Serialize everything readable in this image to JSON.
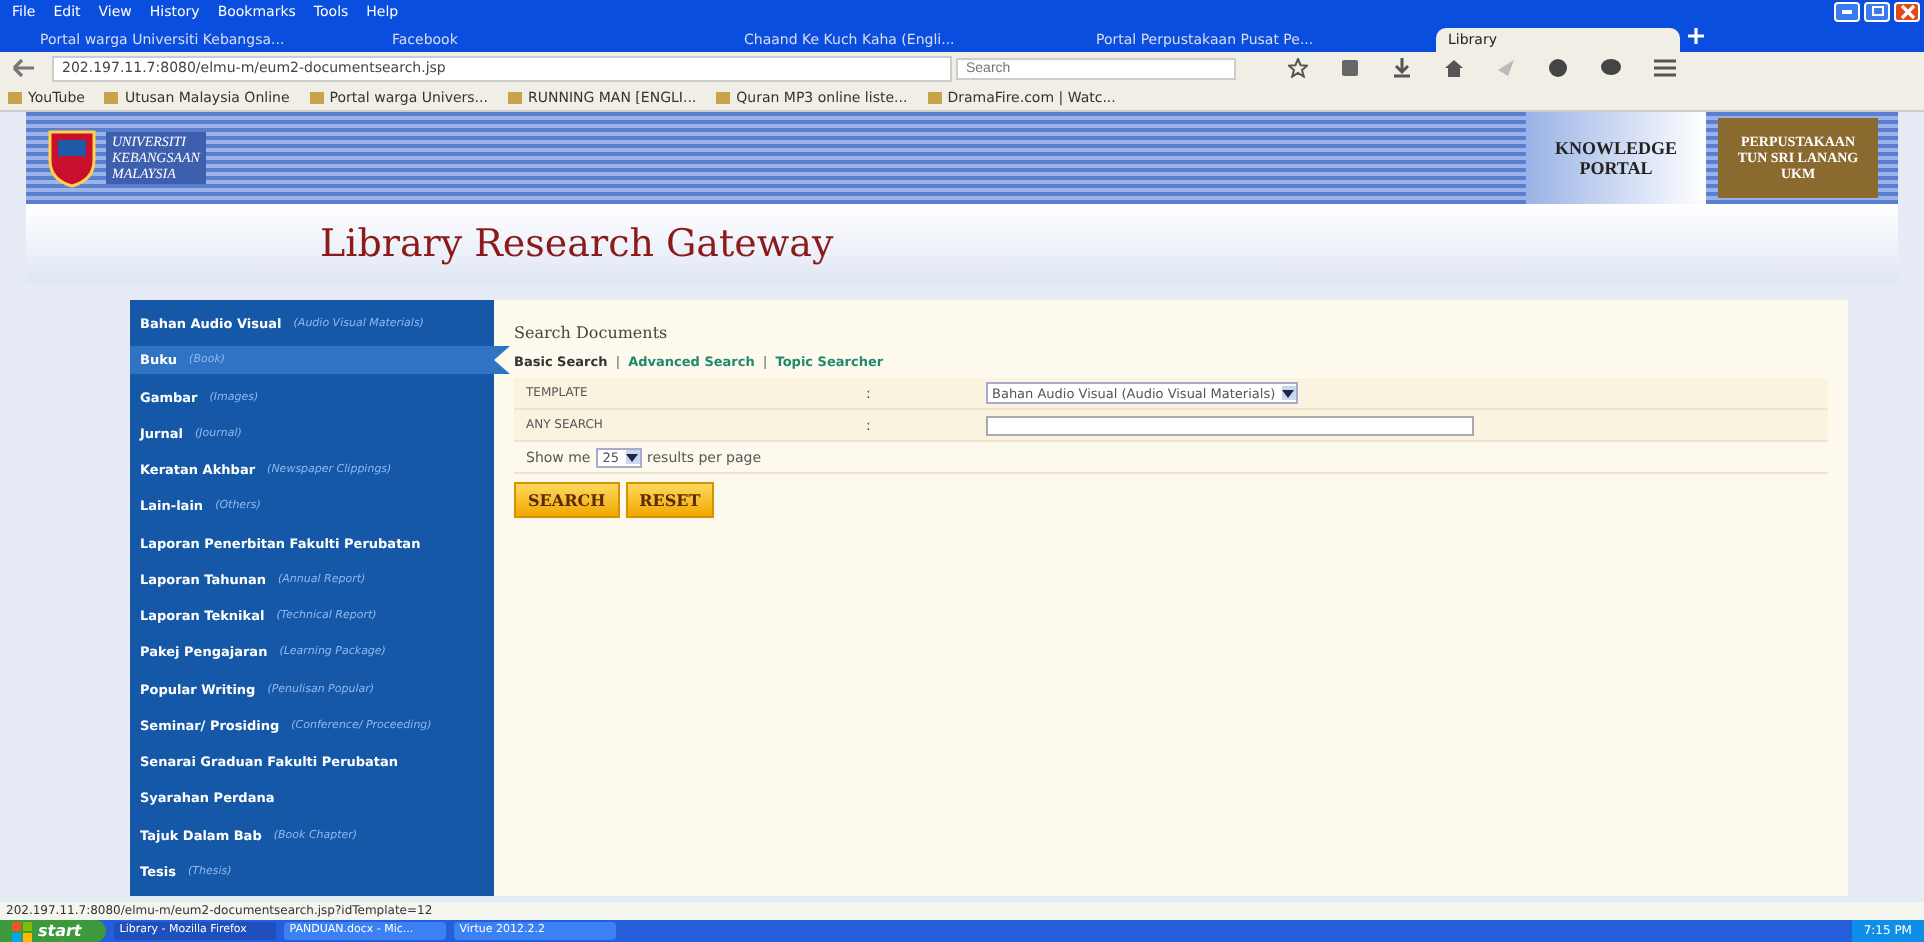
{
  "browser": {
    "menu": [
      "File",
      "Edit",
      "View",
      "History",
      "Bookmarks",
      "Tools",
      "Help"
    ],
    "tabs": [
      {
        "label": "Portal warga Universiti Kebangsa...",
        "selected": false
      },
      {
        "label": "Facebook",
        "selected": false
      },
      {
        "label": "Chaand Ke Kuch Kaha (Engli...",
        "selected": false
      },
      {
        "label": "Portal Perpustakaan Pusat Pe...",
        "selected": false
      },
      {
        "label": "Library",
        "selected": true
      }
    ],
    "url": "202.197.11.7:8080/elmu-m/eum2-documentsearch.jsp",
    "search_placeholder": "Search",
    "bookmarks": [
      "YouTube",
      "Utusan Malaysia Online",
      "Portal warga Univers...",
      "RUNNING MAN [ENGLI...",
      "Quran MP3 online liste...",
      "DramaFire.com | Watc..."
    ]
  },
  "header": {
    "university": [
      "UNIVERSITI",
      "KEBANGSAAN",
      "MALAYSIA"
    ],
    "portal": [
      "KNOWLEDGE",
      "PORTAL"
    ],
    "library": [
      "PERPUSTAKAAN",
      "TUN SRI LANANG",
      "UKM"
    ]
  },
  "title": "Library Research Gateway",
  "sidebar": {
    "items": [
      {
        "label": "Bahan Audio Visual",
        "english": "(Audio Visual Materials)",
        "selected": false
      },
      {
        "label": "Buku",
        "english": "(Book)",
        "selected": true
      },
      {
        "label": "Gambar",
        "english": "(Images)",
        "selected": false
      },
      {
        "label": "Jurnal",
        "english": "(Journal)",
        "selected": false
      },
      {
        "label": "Keratan Akhbar",
        "english": "(Newspaper Clippings)",
        "selected": false
      },
      {
        "label": "Lain-lain",
        "english": "(Others)",
        "selected": false
      },
      {
        "label": "Laporan Penerbitan Fakulti Perubatan",
        "selected": false
      },
      {
        "label": "Laporan Tahunan",
        "english": "(Annual Report)",
        "selected": false
      },
      {
        "label": "Laporan Teknikal",
        "english": "(Technical Report)",
        "selected": false
      },
      {
        "label": "Pakej Pengajaran",
        "english": "(Learning Package)",
        "selected": false
      },
      {
        "label": "Popular Writing",
        "english": "(Penulisan Popular)",
        "selected": false
      },
      {
        "label": "Seminar/ Prosiding",
        "english": "(Conference/ Proceeding)",
        "selected": false
      },
      {
        "label": "Senarai Graduan Fakulti Perubatan",
        "selected": false
      },
      {
        "label": "Syarahan Perdana",
        "selected": false
      },
      {
        "label": "Tajuk Dalam Bab",
        "english": "(Book Chapter)",
        "selected": false
      },
      {
        "label": "Tesis",
        "english": "(Thesis)",
        "selected": false
      }
    ]
  },
  "search": {
    "heading": "Search Documents",
    "modes": [
      {
        "label": "Basic Search",
        "selected": true
      },
      {
        "label": "Advanced Search",
        "selected": false
      },
      {
        "label": "Topic Searcher",
        "selected": false
      }
    ],
    "fields": [
      {
        "kind": "select",
        "label": "TEMPLATE",
        "separator": ":",
        "value": "Bahan Audio Visual (Audio Visual Materials)"
      },
      {
        "kind": "text",
        "label": "ANY SEARCH",
        "separator": ":"
      }
    ],
    "mode_separator": "|",
    "per_page": {
      "before": "Show me",
      "value": "25",
      "after": "results per page"
    },
    "buttons": [
      "SEARCH",
      "RESET"
    ]
  },
  "status_bar": "202.197.11.7:8080/elmu-m/eum2-documentsearch.jsp?idTemplate=12",
  "taskbar": {
    "start": "start",
    "items": [
      {
        "label": "Library - Mozilla Firefox",
        "selected": true
      },
      {
        "label": "PANDUAN.docx - Mic...",
        "selected": false
      },
      {
        "label": "Virtue 2012.2.2",
        "selected": false
      }
    ],
    "clock": "7:15 PM"
  }
}
